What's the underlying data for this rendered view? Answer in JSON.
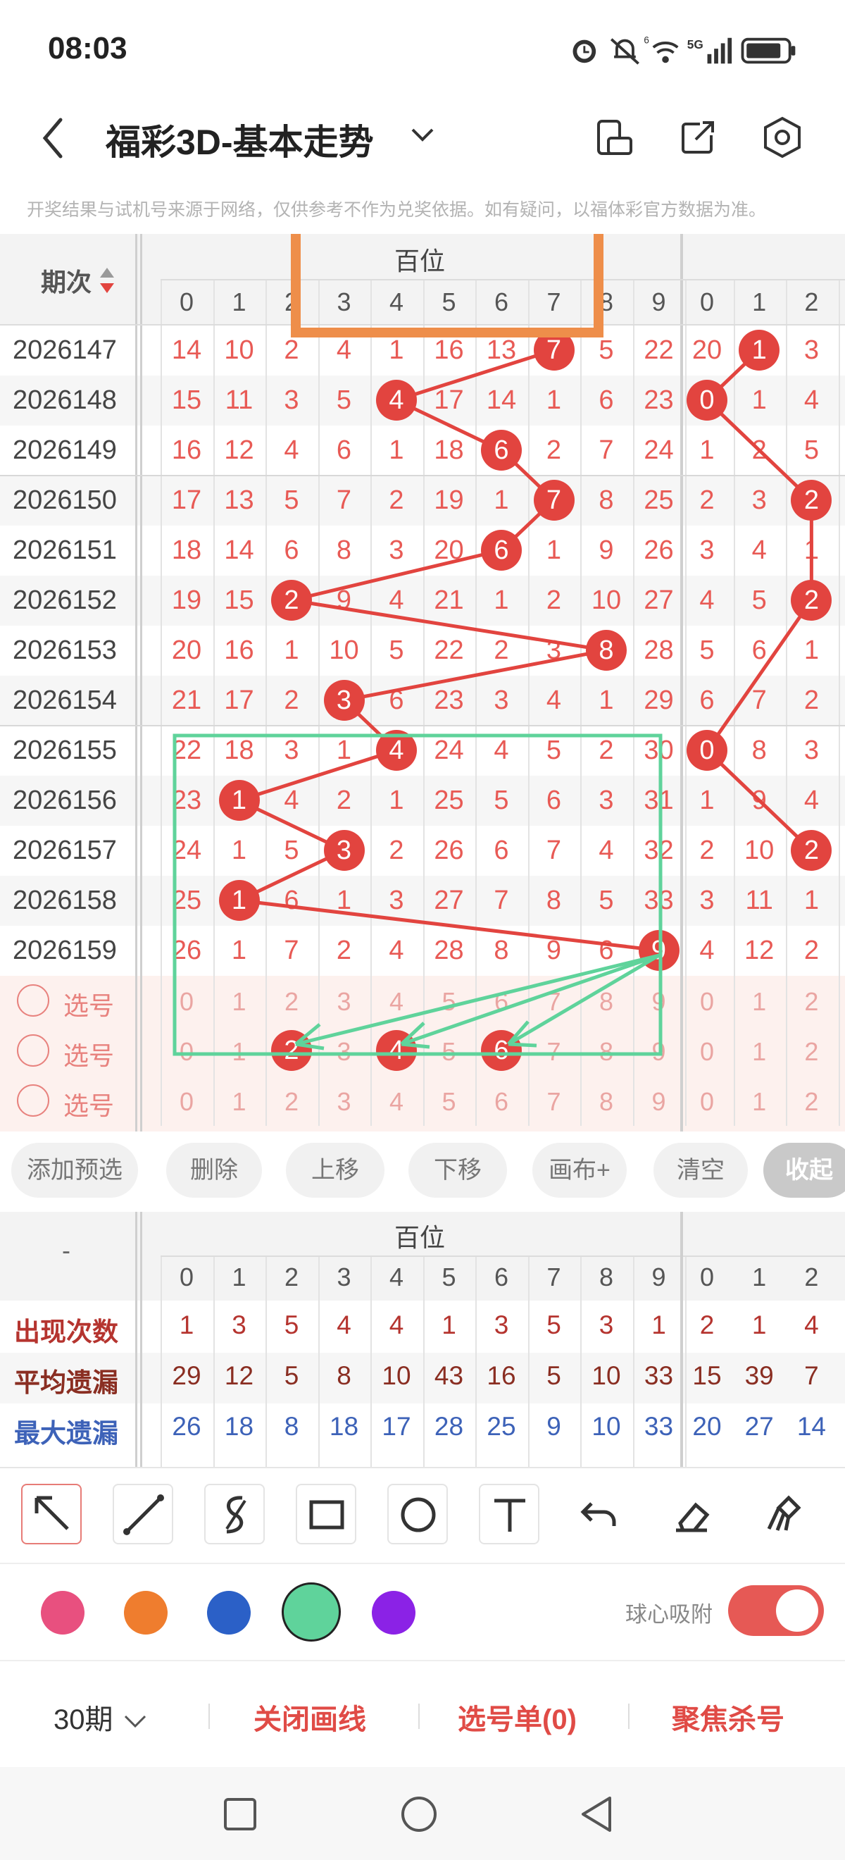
{
  "status_bar": {
    "time": "08:03",
    "network": "5G",
    "wifi": "6"
  },
  "header": {
    "title": "福彩3D-基本走势"
  },
  "notice": "开奖结果与试机号来源于网络，仅供参考不作为兑奖依据。如有疑问，以福体彩官方数据为准。",
  "table": {
    "issue_header": "期次",
    "group_header": "百位",
    "columns": [
      "0",
      "1",
      "2",
      "3",
      "4",
      "5",
      "6",
      "7",
      "8",
      "9"
    ],
    "next_columns": [
      "0",
      "1",
      "2"
    ],
    "rows": [
      {
        "issue": "2026147",
        "cells": [
          "14",
          "10",
          "2",
          "4",
          "1",
          "16",
          "13",
          "7",
          "5",
          "22"
        ],
        "next": [
          "20",
          "1",
          "3"
        ]
      },
      {
        "issue": "2026148",
        "cells": [
          "15",
          "11",
          "3",
          "5",
          "4",
          "17",
          "14",
          "1",
          "6",
          "23"
        ],
        "next": [
          "0",
          "1",
          "4"
        ]
      },
      {
        "issue": "2026149",
        "cells": [
          "16",
          "12",
          "4",
          "6",
          "1",
          "18",
          "6",
          "2",
          "7",
          "24"
        ],
        "next": [
          "1",
          "2",
          "5"
        ]
      },
      {
        "issue": "2026150",
        "cells": [
          "17",
          "13",
          "5",
          "7",
          "2",
          "19",
          "1",
          "7",
          "8",
          "25"
        ],
        "next": [
          "2",
          "3",
          "2"
        ]
      },
      {
        "issue": "2026151",
        "cells": [
          "18",
          "14",
          "6",
          "8",
          "3",
          "20",
          "6",
          "1",
          "9",
          "26"
        ],
        "next": [
          "3",
          "4",
          "1"
        ]
      },
      {
        "issue": "2026152",
        "cells": [
          "19",
          "15",
          "2",
          "9",
          "4",
          "21",
          "1",
          "2",
          "10",
          "27"
        ],
        "next": [
          "4",
          "5",
          "2"
        ]
      },
      {
        "issue": "2026153",
        "cells": [
          "20",
          "16",
          "1",
          "10",
          "5",
          "22",
          "2",
          "3",
          "8",
          "28"
        ],
        "next": [
          "5",
          "6",
          "1"
        ]
      },
      {
        "issue": "2026154",
        "cells": [
          "21",
          "17",
          "2",
          "3",
          "6",
          "23",
          "3",
          "4",
          "1",
          "29"
        ],
        "next": [
          "6",
          "7",
          "2"
        ]
      },
      {
        "issue": "2026155",
        "cells": [
          "22",
          "18",
          "3",
          "1",
          "4",
          "24",
          "4",
          "5",
          "2",
          "30"
        ],
        "next": [
          "0",
          "8",
          "3"
        ]
      },
      {
        "issue": "2026156",
        "cells": [
          "23",
          "1",
          "4",
          "2",
          "1",
          "25",
          "5",
          "6",
          "3",
          "31"
        ],
        "next": [
          "1",
          "9",
          "4"
        ]
      },
      {
        "issue": "2026157",
        "cells": [
          "24",
          "1",
          "5",
          "3",
          "2",
          "26",
          "6",
          "7",
          "4",
          "32"
        ],
        "next": [
          "2",
          "10",
          "2"
        ]
      },
      {
        "issue": "2026158",
        "cells": [
          "25",
          "1",
          "6",
          "1",
          "3",
          "27",
          "7",
          "8",
          "5",
          "33"
        ],
        "next": [
          "3",
          "11",
          "1"
        ]
      },
      {
        "issue": "2026159",
        "cells": [
          "26",
          "1",
          "7",
          "2",
          "4",
          "28",
          "8",
          "9",
          "6",
          "9"
        ],
        "next": [
          "4",
          "12",
          "2"
        ]
      }
    ],
    "hit_columns": [
      7,
      4,
      6,
      7,
      6,
      2,
      8,
      3,
      4,
      1,
      3,
      1,
      9
    ],
    "next_hit_columns": [
      1,
      0,
      null,
      2,
      null,
      2,
      null,
      null,
      0,
      null,
      2,
      null,
      null
    ],
    "pick_label": "选号",
    "pick_rows": 3,
    "pick_marked": [
      2,
      4,
      6
    ]
  },
  "actions": [
    "添加预选",
    "删除",
    "上移",
    "下移",
    "画布+",
    "清空",
    "收起"
  ],
  "stats": {
    "group_header": "百位",
    "dash": "-",
    "columns": [
      "0",
      "1",
      "2",
      "3",
      "4",
      "5",
      "6",
      "7",
      "8",
      "9"
    ],
    "next_columns": [
      "0",
      "1",
      "2"
    ],
    "rows": [
      {
        "label": "出现次数",
        "color": "#b5342f",
        "values": [
          "1",
          "3",
          "5",
          "4",
          "4",
          "1",
          "3",
          "5",
          "3",
          "1",
          "2",
          "1",
          "4"
        ]
      },
      {
        "label": "平均遗漏",
        "color": "#8a2e22",
        "values": [
          "29",
          "12",
          "5",
          "8",
          "10",
          "43",
          "16",
          "5",
          "10",
          "33",
          "15",
          "39",
          "7"
        ]
      },
      {
        "label": "最大遗漏",
        "color": "#3d62b8",
        "values": [
          "26",
          "18",
          "8",
          "18",
          "17",
          "28",
          "25",
          "9",
          "10",
          "33",
          "20",
          "27",
          "14"
        ]
      }
    ]
  },
  "tools": [
    "pointer-icon",
    "line-icon",
    "freehand-icon",
    "rectangle-icon",
    "circle-icon",
    "text-icon",
    "undo-icon",
    "eraser-icon",
    "brush-clear-icon"
  ],
  "palette": [
    "#e8507f",
    "#ef7d2e",
    "#2b60c7",
    "#5fd39b",
    "#8b22e6"
  ],
  "snap_label": "球心吸附",
  "bottom": {
    "period": "30期",
    "close_draw": "关闭画线",
    "pick_list": "选号单(0)",
    "focus_kill": "聚焦杀号"
  }
}
